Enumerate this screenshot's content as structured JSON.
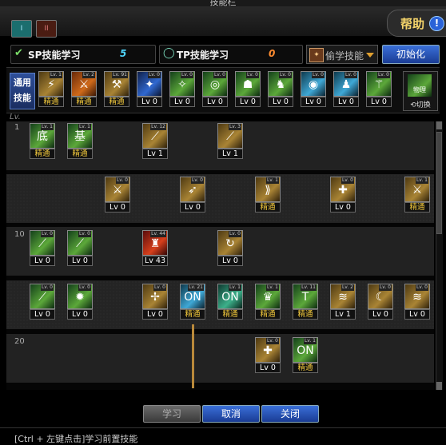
{
  "window": {
    "title": "技能栏"
  },
  "tabs": [
    {
      "label": "I"
    },
    {
      "label": "II"
    }
  ],
  "help": {
    "label": "帮助",
    "icon": "!"
  },
  "sp": {
    "label": "SP技能学习",
    "value": "5",
    "color": "#4fd6ff"
  },
  "tp": {
    "label": "TP技能学习",
    "value": "0",
    "color": "#ff8c30"
  },
  "steal": {
    "label": "偷学技能"
  },
  "init": {
    "label": "初始化"
  },
  "common": {
    "label": "通用技能",
    "skills": [
      {
        "lv": "Lv. 1",
        "tag": "精通",
        "color": "gold",
        "glyph": "⚡"
      },
      {
        "lv": "Lv. 2",
        "tag": "精通",
        "color": "orange",
        "glyph": "⚔"
      },
      {
        "lv": "Lv. 91",
        "tag": "精通",
        "color": "gold",
        "glyph": "⚒"
      },
      {
        "lv": "Lv. 0",
        "tag": "Lv 0",
        "color": "blue",
        "glyph": "✦"
      },
      {
        "lv": "Lv. 0",
        "tag": "Lv 0",
        "color": "green",
        "glyph": "✧"
      },
      {
        "lv": "Lv. 0",
        "tag": "Lv 0",
        "color": "green",
        "glyph": "◎"
      },
      {
        "lv": "Lv. 0",
        "tag": "Lv 0",
        "color": "green",
        "glyph": "☗"
      },
      {
        "lv": "Lv. 0",
        "tag": "Lv 0",
        "color": "green",
        "glyph": "♞"
      },
      {
        "lv": "Lv. 0",
        "tag": "Lv 0",
        "color": "cyan",
        "glyph": "◉"
      },
      {
        "lv": "Lv. 0",
        "tag": "Lv 0",
        "color": "cyan",
        "glyph": "♟"
      },
      {
        "lv": "Lv. 0",
        "tag": "Lv 0",
        "color": "green",
        "glyph": "⚚"
      }
    ],
    "exchange": {
      "label": "切换",
      "icon_text": "物理"
    }
  },
  "tree": {
    "lv_label": "Lv.",
    "row_numbers": [
      "1",
      "10",
      "20"
    ],
    "rows": [
      [
        {
          "lv": "Lv. 1",
          "tag": "精通",
          "color": "green",
          "glyph": "底"
        },
        {
          "lv": "Lv. 1",
          "tag": "精通",
          "color": "green",
          "glyph": "基"
        },
        {
          "lv": "Lv. 12",
          "tag": "Lv 1",
          "color": "gold",
          "glyph": "⟋"
        },
        {
          "lv": "Lv. 3",
          "tag": "Lv 1",
          "color": "gold",
          "glyph": "⟋"
        }
      ],
      [
        {
          "lv": "Lv. 0",
          "tag": "Lv 0",
          "color": "gold",
          "glyph": "⚔"
        },
        {
          "lv": "Lv. 0",
          "tag": "Lv 0",
          "color": "gold",
          "glyph": "➶"
        },
        {
          "lv": "Lv. 1",
          "tag": "精通",
          "color": "gold",
          "glyph": "⟫"
        },
        {
          "lv": "Lv. 0",
          "tag": "Lv 0",
          "color": "gold",
          "glyph": "✚"
        },
        {
          "lv": "Lv. 1",
          "tag": "精通",
          "color": "gold",
          "glyph": "⚔"
        }
      ],
      [
        {
          "lv": "Lv. 0",
          "tag": "Lv 0",
          "color": "green",
          "glyph": "⟋"
        },
        {
          "lv": "Lv. 0",
          "tag": "Lv 0",
          "color": "green",
          "glyph": "⟋"
        },
        {
          "lv": "Lv. 44",
          "tag": "Lv 43",
          "color": "red",
          "glyph": "♜"
        },
        {
          "lv": "Lv. 0",
          "tag": "Lv 0",
          "color": "gold",
          "glyph": "↻"
        }
      ],
      [
        {
          "lv": "Lv. 0",
          "tag": "Lv 0",
          "color": "green",
          "glyph": "⟋"
        },
        {
          "lv": "Lv. 0",
          "tag": "Lv 0",
          "color": "green",
          "glyph": "✹"
        },
        {
          "lv": "Lv. 0",
          "tag": "Lv 0",
          "color": "gold",
          "glyph": "✢"
        },
        {
          "lv": "Lv. 21",
          "tag": "精通",
          "color": "cyan",
          "glyph": "ON"
        },
        {
          "lv": "Lv. 1",
          "tag": "精通",
          "color": "teal",
          "glyph": "ON"
        },
        {
          "lv": "Lv. 1",
          "tag": "精通",
          "color": "green",
          "glyph": "♛"
        },
        {
          "lv": "Lv. 11",
          "tag": "精通",
          "color": "green",
          "glyph": "T"
        },
        {
          "lv": "Lv. 2",
          "tag": "Lv 1",
          "color": "gold",
          "glyph": "≋"
        },
        {
          "lv": "Lv. 0",
          "tag": "Lv 0",
          "color": "gold",
          "glyph": "☾"
        },
        {
          "lv": "Lv. 0",
          "tag": "Lv 0",
          "color": "gold",
          "glyph": "≋"
        }
      ],
      [
        {
          "lv": "Lv. 0",
          "tag": "Lv 0",
          "color": "gold",
          "glyph": "✚"
        },
        {
          "lv": "Lv. 1",
          "tag": "精通",
          "color": "green",
          "glyph": "ON"
        }
      ]
    ]
  },
  "buttons": {
    "learn": "学习",
    "cancel": "取消",
    "close": "关闭"
  },
  "hint": "[Ctrl + 左键点击]学习前置技能"
}
